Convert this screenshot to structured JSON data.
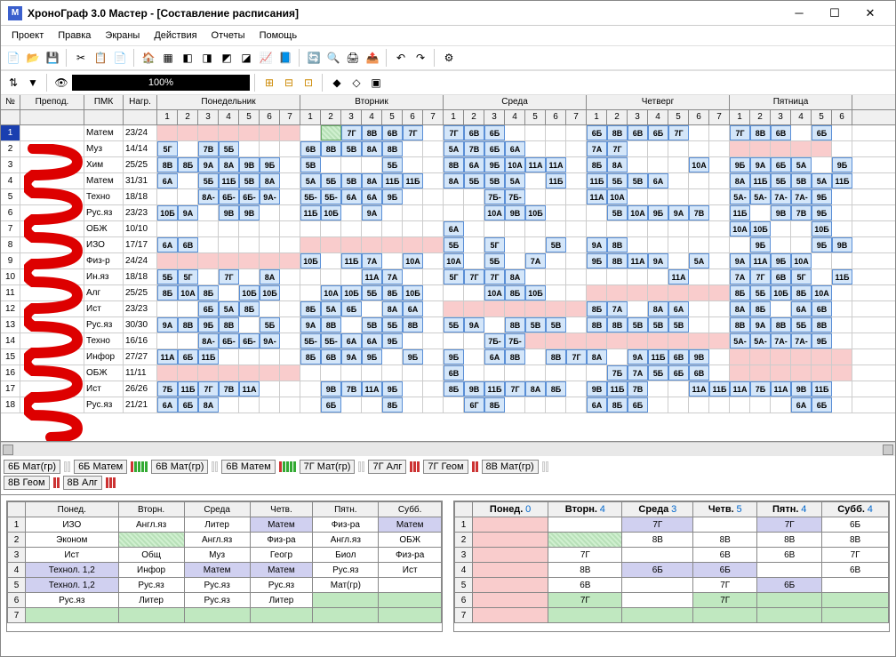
{
  "title": "ХроноГраф 3.0 Мастер - [Составление расписания]",
  "menu": [
    "Проект",
    "Правка",
    "Экраны",
    "Действия",
    "Отчеты",
    "Помощь"
  ],
  "progress": "100%",
  "days": [
    "Понедельник",
    "Вторник",
    "Среда",
    "Четверг",
    "Пятница"
  ],
  "day_periods": [
    7,
    7,
    7,
    7,
    6
  ],
  "header_cols": {
    "num": "№",
    "teacher": "Препод.",
    "subj": "ПМК",
    "load": "Нагр."
  },
  "rows": [
    {
      "n": 1,
      "t": "",
      "s": "Матем",
      "l": "23/24",
      "sel": true,
      "les": [
        [
          "p",
          "p",
          "p",
          "p",
          "p",
          "p",
          "p"
        ],
        [
          "",
          "st",
          "7Г",
          "8В",
          "6В",
          "7Г",
          ""
        ],
        [
          "7Г",
          "6В",
          "6Б",
          "",
          "",
          " ",
          ""
        ],
        [
          "6Б",
          "8В",
          "6В",
          "6Б",
          "7Г",
          "",
          ""
        ],
        [
          "7Г",
          "8В",
          "6В",
          "",
          "6Б",
          ""
        ]
      ]
    },
    {
      "n": 2,
      "t": "",
      "s": "Муз",
      "l": "14/14",
      "les": [
        [
          "5Г",
          "",
          "7В",
          "5Б",
          "",
          "",
          ""
        ],
        [
          "6В",
          "8В",
          "5В",
          "8А",
          "8В",
          "",
          ""
        ],
        [
          "5А",
          "7В",
          "6Б",
          "6А",
          "",
          "",
          ""
        ],
        [
          "7А",
          "7Г",
          "",
          "",
          "",
          "",
          ""
        ],
        [
          "p",
          "p",
          "p",
          "p",
          "p",
          ""
        ]
      ]
    },
    {
      "n": 3,
      "t": "",
      "s": "Хим",
      "l": "25/25",
      "les": [
        [
          "8В",
          "8Б",
          "9А",
          "8А",
          "9В",
          "9Б",
          ""
        ],
        [
          "5В",
          "",
          "",
          "",
          "5Б",
          "",
          ""
        ],
        [
          "8В",
          "6А",
          "9Б",
          "10А",
          "11А",
          "11А",
          ""
        ],
        [
          "8Б",
          "8А",
          "",
          "",
          "",
          "10А",
          ""
        ],
        [
          "9Б",
          "9А",
          "6Б",
          "5А",
          "",
          "9Б"
        ]
      ]
    },
    {
      "n": 4,
      "t": "",
      "s": "Матем",
      "l": "31/31",
      "les": [
        [
          "6А",
          "",
          "5Б",
          "11Б",
          "5В",
          "8А",
          ""
        ],
        [
          "5А",
          "5Б",
          "5В",
          "8А",
          "11Б",
          "11Б",
          ""
        ],
        [
          "8А",
          "5Б",
          "5В",
          "5А",
          "",
          "11Б",
          ""
        ],
        [
          "11Б",
          "5Б",
          "5В",
          "6А",
          "",
          "",
          ""
        ],
        [
          "8А",
          "11Б",
          "5Б",
          "5В",
          "5А",
          "11Б"
        ]
      ]
    },
    {
      "n": 5,
      "t": "",
      "s": "Техно",
      "l": "18/18",
      "les": [
        [
          "",
          "",
          "8А-",
          "6Б-",
          "6Б-",
          "9А-",
          ""
        ],
        [
          "5Б-",
          "5Б-",
          "6А",
          "6А",
          "9Б",
          "",
          ""
        ],
        [
          "",
          "",
          "7Б-",
          "7Б-",
          "",
          "",
          ""
        ],
        [
          "11А",
          "10А",
          "",
          "",
          "",
          "",
          ""
        ],
        [
          "5А-",
          "5А-",
          "7А-",
          "7А-",
          "9Б",
          ""
        ]
      ]
    },
    {
      "n": 6,
      "t": "",
      "s": "Рус.яз",
      "l": "23/23",
      "les": [
        [
          "10Б",
          "9А",
          "",
          "9В",
          "9В",
          "",
          ""
        ],
        [
          "11Б",
          "10Б",
          "",
          "9А",
          "",
          "",
          ""
        ],
        [
          "",
          "",
          "10А",
          "9В",
          "10Б",
          "",
          ""
        ],
        [
          "",
          "5В",
          "10А",
          "9Б",
          "9А",
          "7В",
          ""
        ],
        [
          "11Б",
          "",
          "9В",
          "7В",
          "9Б",
          ""
        ]
      ]
    },
    {
      "n": 7,
      "t": "",
      "s": "ОБЖ",
      "l": "10/10",
      "les": [
        [
          "",
          "",
          "",
          "",
          "",
          "",
          ""
        ],
        [
          "",
          "",
          "",
          "",
          "",
          "",
          ""
        ],
        [
          "6А",
          "",
          "",
          "",
          "",
          "",
          ""
        ],
        [
          "",
          "",
          "",
          "",
          "",
          "",
          ""
        ],
        [
          "10А",
          "10Б",
          "",
          "",
          "10Б",
          ""
        ]
      ]
    },
    {
      "n": 8,
      "t": "",
      "s": "ИЗО",
      "l": "17/17",
      "les": [
        [
          "6А",
          "6В",
          "",
          "",
          "",
          "",
          ""
        ],
        [
          "p",
          "p",
          "p",
          "p",
          "p",
          "p",
          "p"
        ],
        [
          "5Б",
          "",
          "5Г",
          "",
          "",
          "5В",
          ""
        ],
        [
          "9А",
          "8В",
          "",
          "",
          "",
          "",
          ""
        ],
        [
          "",
          "9Б",
          "",
          "",
          "9Б",
          "9В"
        ]
      ]
    },
    {
      "n": 9,
      "t": "",
      "s": "Физ-р",
      "l": "24/24",
      "les": [
        [
          "p",
          "p",
          "p",
          "p",
          "p",
          "p",
          "p"
        ],
        [
          "10Б",
          "",
          "11Б",
          "7А",
          "",
          "10А",
          ""
        ],
        [
          "10А",
          "",
          "5Б",
          "",
          "7А",
          "",
          ""
        ],
        [
          "9Б",
          "8В",
          "11А",
          "9А",
          "",
          "5А",
          ""
        ],
        [
          "9А",
          "11А",
          "9Б",
          "10А",
          "",
          ""
        ]
      ]
    },
    {
      "n": 10,
      "t": "",
      "s": "Ин.яз",
      "l": "18/18",
      "les": [
        [
          "5Б",
          "5Г",
          "",
          "7Г",
          "",
          "8А",
          ""
        ],
        [
          "",
          "",
          "",
          "11А",
          "7А",
          "",
          ""
        ],
        [
          "5Г",
          "7Г",
          "7Г",
          "8А",
          "",
          "",
          ""
        ],
        [
          "",
          "",
          "",
          "",
          "11А",
          "",
          ""
        ],
        [
          "7А",
          "7Г",
          "6В",
          "5Г",
          "",
          "11Б"
        ]
      ]
    },
    {
      "n": 11,
      "t": "",
      "s": "Алг",
      "l": "25/25",
      "les": [
        [
          "8Б",
          "10А",
          "8Б",
          "",
          "10Б",
          "10Б",
          ""
        ],
        [
          "",
          "10А",
          "10Б",
          "5Б",
          "8Б",
          "10Б",
          ""
        ],
        [
          "",
          "",
          "10А",
          "8Б",
          "10Б",
          "",
          ""
        ],
        [
          "p",
          "p",
          "p",
          "p",
          "p",
          "p",
          "p"
        ],
        [
          "8Б",
          "5Б",
          "10Б",
          "8Б",
          "10А",
          ""
        ]
      ]
    },
    {
      "n": 12,
      "t": "",
      "s": "Ист",
      "l": "23/23",
      "les": [
        [
          "",
          "",
          "6Б",
          "5А",
          "8Б",
          "",
          ""
        ],
        [
          "8Б",
          "5А",
          "6Б",
          "",
          "8А",
          "6А",
          ""
        ],
        [
          "p",
          "p",
          "p",
          "p",
          "p",
          "p",
          "p"
        ],
        [
          "8Б",
          "7А",
          "",
          "8А",
          "6А",
          "",
          ""
        ],
        [
          "8А",
          "8Б",
          "",
          "6А",
          "6В",
          ""
        ]
      ]
    },
    {
      "n": 13,
      "t": "",
      "s": "Рус.яз",
      "l": "30/30",
      "les": [
        [
          "9А",
          "8В",
          "9Б",
          "8В",
          "",
          "5Б",
          ""
        ],
        [
          "9А",
          "8В",
          "",
          "5В",
          "5Б",
          "8В",
          ""
        ],
        [
          "5Б",
          "9А",
          "",
          "8В",
          "5В",
          "5В",
          ""
        ],
        [
          "8В",
          "8В",
          "5В",
          "5В",
          "5В",
          "",
          ""
        ],
        [
          "8В",
          "9А",
          "8В",
          "5Б",
          "8В",
          ""
        ]
      ]
    },
    {
      "n": 14,
      "t": "",
      "s": "Техно",
      "l": "16/16",
      "les": [
        [
          "",
          "",
          "8А-",
          "6Б-",
          "6Б-",
          "9А-",
          ""
        ],
        [
          "5Б-",
          "5Б-",
          "6А",
          "6А",
          "9Б",
          "",
          ""
        ],
        [
          "",
          "",
          "7Б-",
          "7Б-",
          "p",
          "p",
          "p"
        ],
        [
          "p",
          "p",
          "p",
          "p",
          "p",
          "p",
          "p"
        ],
        [
          "5А-",
          "5А-",
          "7А-",
          "7А-",
          "9Б",
          ""
        ]
      ]
    },
    {
      "n": 15,
      "t": "",
      "s": "Инфор",
      "l": "27/27",
      "les": [
        [
          "11А",
          "6Б",
          "11Б",
          "",
          "",
          "",
          ""
        ],
        [
          "8Б",
          "6В",
          "9А",
          "9Б",
          "",
          "9Б",
          ""
        ],
        [
          "9Б",
          "",
          "6А",
          "8В",
          "",
          "8В",
          "7Г"
        ],
        [
          "8А",
          "",
          "9А",
          "11Б",
          "6В",
          "9В",
          ""
        ],
        [
          "p",
          "p",
          "p",
          "p",
          "p",
          "p"
        ]
      ]
    },
    {
      "n": 16,
      "t": "",
      "s": "ОБЖ",
      "l": "11/11",
      "les": [
        [
          "p",
          "p",
          "p",
          "p",
          "p",
          "p",
          "p"
        ],
        [
          "",
          "",
          "",
          "",
          "",
          "",
          ""
        ],
        [
          "6В",
          "",
          "",
          "",
          "",
          "",
          ""
        ],
        [
          "",
          "7Б",
          "7А",
          "5Б",
          "6Б",
          "6В",
          ""
        ],
        [
          "p",
          "p",
          "p",
          "p",
          "p",
          "p"
        ]
      ]
    },
    {
      "n": 17,
      "t": "",
      "s": "Ист",
      "l": "26/26",
      "les": [
        [
          "7Б",
          "11Б",
          "7Г",
          "7В",
          "11А",
          "",
          ""
        ],
        [
          "",
          "9В",
          "7В",
          "11А",
          "9Б",
          "",
          ""
        ],
        [
          "8Б",
          "9В",
          "11Б",
          "7Г",
          "8А",
          "8Б",
          ""
        ],
        [
          "9В",
          "11Б",
          "7В",
          "",
          "",
          "11А",
          "11Б"
        ],
        [
          "11А",
          "7Б",
          "11А",
          "9В",
          "11Б",
          ""
        ]
      ]
    },
    {
      "n": 18,
      "t": "",
      "s": "Рус.яз",
      "l": "21/21",
      "les": [
        [
          "6А",
          "6Б",
          "8А",
          "",
          "",
          "",
          ""
        ],
        [
          "",
          "6Б",
          "",
          "",
          "8Б",
          "",
          ""
        ],
        [
          "",
          "6Г",
          "8Б",
          "",
          "",
          "",
          ""
        ],
        [
          "6А",
          "8Б",
          "6Б",
          "",
          "",
          "",
          ""
        ],
        [
          "",
          "",
          "",
          "6А",
          "6Б",
          ""
        ]
      ]
    }
  ],
  "status1": [
    {
      "label": "6Б Мат(гр)",
      "bars": [
        "e",
        "e"
      ]
    },
    {
      "label": "6Б Матем",
      "bars": [
        "r",
        "g",
        "g",
        "g",
        "g"
      ]
    },
    {
      "label": "6В Мат(гр)",
      "bars": [
        "e",
        "e"
      ]
    },
    {
      "label": "6В Матем",
      "bars": [
        "r",
        "g",
        "g",
        "g",
        "g"
      ]
    },
    {
      "label": "7Г Мат(гр)",
      "bars": [
        "e",
        "e"
      ]
    },
    {
      "label": "7Г Алг",
      "bars": [
        "r",
        "r",
        "r"
      ]
    },
    {
      "label": "7Г Геом",
      "bars": [
        "r",
        "r"
      ]
    },
    {
      "label": "8В Мат(гр)",
      "bars": [
        "e",
        "e"
      ]
    }
  ],
  "status2": [
    {
      "label": "8В Геом",
      "bars": [
        "r",
        "r"
      ]
    },
    {
      "label": "8В Алг",
      "bars": [
        "r",
        "r",
        "r"
      ]
    }
  ],
  "panelL": {
    "head": [
      "Понед.",
      "Вторн.",
      "Среда",
      "Четв.",
      "Пятн.",
      "Субб."
    ],
    "rows": [
      [
        "1",
        "ИЗО",
        "Англ.яз",
        "Литер",
        "Матем",
        "Физ-ра",
        "Матем"
      ],
      [
        "2",
        "Эконом",
        "",
        "Англ.яз",
        "Физ-ра",
        "Англ.яз",
        "ОБЖ"
      ],
      [
        "3",
        "Ист",
        "Общ",
        "Муз",
        "Геогр",
        "Биол",
        "Физ-ра"
      ],
      [
        "4",
        "Технол. 1,2",
        "Инфор",
        "Матем",
        "Матем",
        "Рус.яз",
        "Ист"
      ],
      [
        "5",
        "Технол. 1,2",
        "Рус.яз",
        "Рус.яз",
        "Рус.яз",
        "Мат(гр)",
        ""
      ],
      [
        "6",
        "Рус.яз",
        "Литер",
        "Рус.яз",
        "Литер",
        "",
        ""
      ],
      [
        "7",
        "",
        "",
        "",
        "",
        "",
        ""
      ]
    ],
    "styles": {
      "0,4": "lav",
      "0,6": "lav",
      "1,2": "dgrn",
      "3,1": "lav",
      "3,3": "lav",
      "3,4": "lav",
      "4,1": "lav",
      "5,5": "grn",
      "5,6": "grn",
      "6,1": "grn",
      "6,2": "grn",
      "6,3": "grn",
      "6,4": "grn",
      "6,5": "grn",
      "6,6": "grn"
    }
  },
  "panelR": {
    "head": [
      [
        "Понед.",
        "0"
      ],
      [
        "Вторн.",
        "4"
      ],
      [
        "Среда",
        "3"
      ],
      [
        "Четв.",
        "5"
      ],
      [
        "Пятн.",
        "4"
      ],
      [
        "Субб.",
        "4"
      ]
    ],
    "rows": [
      [
        "1",
        "",
        "",
        "7Г",
        "",
        "7Г",
        "6Б"
      ],
      [
        "2",
        "",
        "",
        "8В",
        "8В",
        "8В",
        "8В"
      ],
      [
        "3",
        "",
        "7Г",
        "",
        "6В",
        "6В",
        "7Г"
      ],
      [
        "4",
        "",
        "8В",
        "6Б",
        "6Б",
        "",
        "6В"
      ],
      [
        "5",
        "",
        "6В",
        "",
        "7Г",
        "6Б",
        ""
      ],
      [
        "6",
        "",
        "7Г",
        "",
        "7Г",
        "",
        ""
      ],
      [
        "7",
        "",
        "",
        "",
        "",
        "",
        ""
      ]
    ],
    "styles": {
      "0,1": "pnk",
      "0,3": "lav",
      "0,5": "lav",
      "1,1": "pnk",
      "1,2": "dgrn",
      "2,1": "pnk",
      "3,1": "pnk",
      "3,3": "lav",
      "3,4": "lav",
      "4,1": "pnk",
      "4,5": "lav",
      "5,1": "pnk",
      "5,2": "grn",
      "5,4": "grn",
      "5,5": "grn",
      "5,6": "grn",
      "6,1": "pnk",
      "6,2": "grn",
      "6,3": "grn",
      "6,4": "grn",
      "6,5": "grn",
      "6,6": "grn"
    }
  }
}
